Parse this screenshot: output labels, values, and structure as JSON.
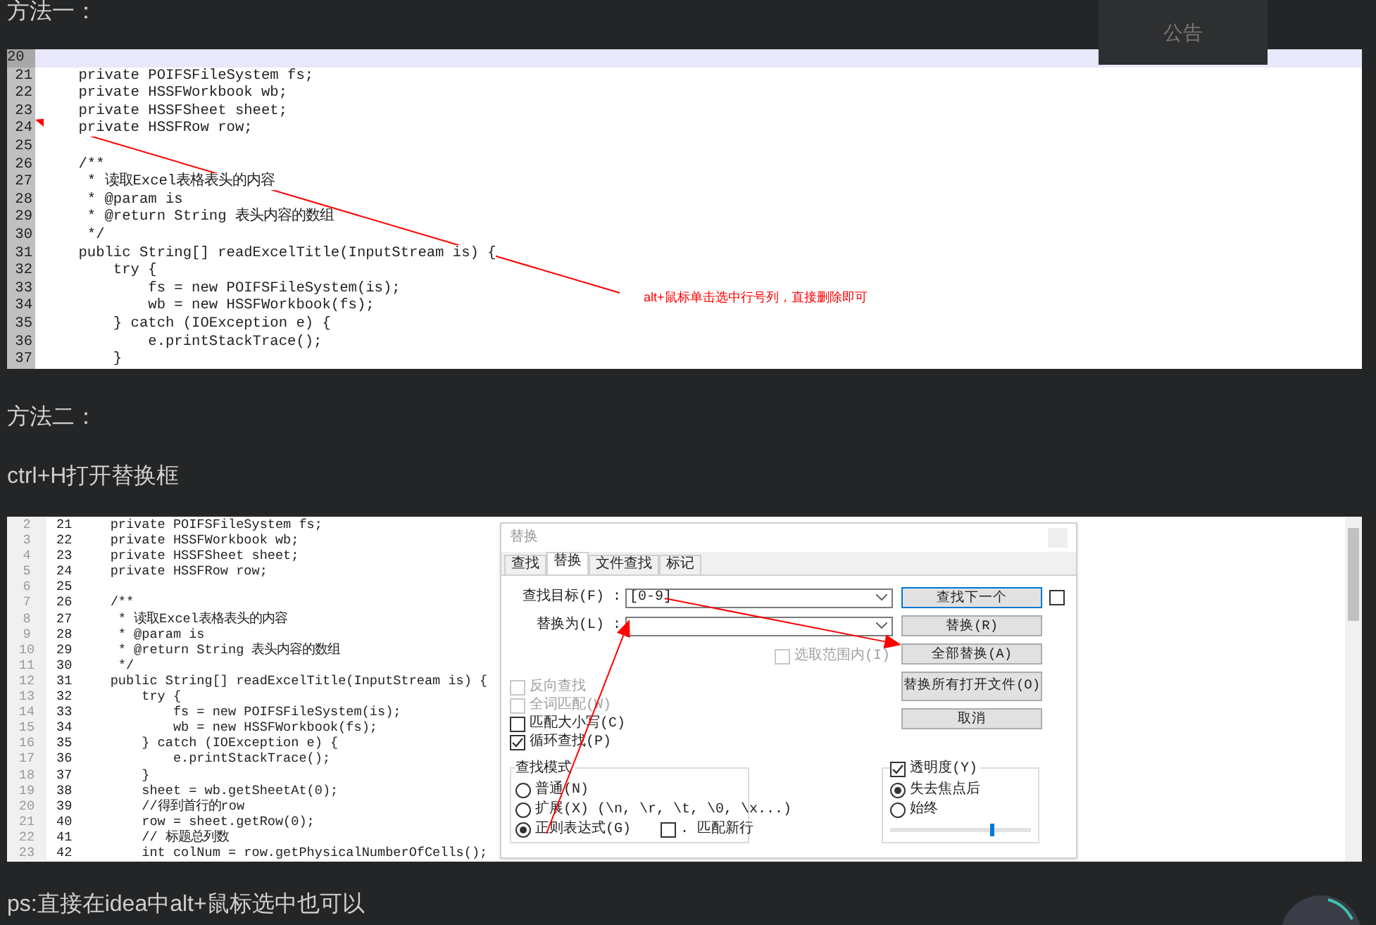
{
  "notice": "公告",
  "method_one": {
    "heading": "方法一：",
    "screenshot": {
      "lines": [
        {
          "number": "20",
          "selected": true
        },
        {
          "number": "21",
          "code": "    private POIFSFileSystem fs;",
          "selected": false
        },
        {
          "number": "22",
          "code": "    private HSSFWorkbook wb;",
          "selected": false
        },
        {
          "number": "23",
          "code": "    private HSSFSheet sheet;",
          "selected": false
        },
        {
          "number": "24",
          "code": "    private HSSFRow row;",
          "selected": false
        },
        {
          "number": "25",
          "selected": false
        },
        {
          "number": "26",
          "code": "    /**",
          "selected": false
        },
        {
          "number": "27",
          "code": "     * 读取Excel表格表头的内容",
          "selected": false
        },
        {
          "number": "28",
          "code": "     * @param is",
          "selected": false
        },
        {
          "number": "29",
          "code": "     * @return String 表头内容的数组",
          "selected": false
        },
        {
          "number": "30",
          "code": "     */",
          "selected": false
        },
        {
          "number": "31",
          "code": "    public String[] readExcelTitle(InputStream is) {",
          "selected": false
        },
        {
          "number": "32",
          "code": "        try {",
          "selected": false
        },
        {
          "number": "33",
          "code": "            fs = new POIFSFileSystem(is);",
          "selected": false
        },
        {
          "number": "34",
          "code": "            wb = new HSSFWorkbook(fs);",
          "selected": false
        },
        {
          "number": "35",
          "code": "        } catch (IOException e) {",
          "selected": false
        },
        {
          "number": "36",
          "code": "            e.printStackTrace();",
          "selected": false
        },
        {
          "number": "37",
          "code": "        }",
          "selected": false
        }
      ],
      "annotation": "alt+鼠标单击选中行号列，直接删除即可"
    }
  },
  "method_two": {
    "heading": "方法二：",
    "instruction": "ctrl+H打开替换框",
    "screenshot": {
      "lines": [
        {
          "row": "2",
          "number": "21",
          "code": "    private POIFSFileSystem fs;"
        },
        {
          "row": "3",
          "number": "22",
          "code": "    private HSSFWorkbook wb;"
        },
        {
          "row": "4",
          "number": "23",
          "code": "    private HSSFSheet sheet;"
        },
        {
          "row": "5",
          "number": "24",
          "code": "    private HSSFRow row;"
        },
        {
          "row": "6",
          "number": "25"
        },
        {
          "row": "7",
          "number": "26",
          "code": "    /**"
        },
        {
          "row": "8",
          "number": "27",
          "code": "     * 读取Excel表格表头的内容"
        },
        {
          "row": "9",
          "number": "28",
          "code": "     * @param is"
        },
        {
          "row": "10",
          "number": "29",
          "code": "     * @return String 表头内容的数组"
        },
        {
          "row": "11",
          "number": "30",
          "code": "     */"
        },
        {
          "row": "12",
          "number": "31",
          "code": "    public String[] readExcelTitle(InputStream is) {"
        },
        {
          "row": "13",
          "number": "32",
          "code": "        try {"
        },
        {
          "row": "14",
          "number": "33",
          "code": "            fs = new POIFSFileSystem(is);"
        },
        {
          "row": "15",
          "number": "34",
          "code": "            wb = new HSSFWorkbook(fs);"
        },
        {
          "row": "16",
          "number": "35",
          "code": "        } catch (IOException e) {"
        },
        {
          "row": "17",
          "number": "36",
          "code": "            e.printStackTrace();"
        },
        {
          "row": "18",
          "number": "37",
          "code": "        }"
        },
        {
          "row": "19",
          "number": "38",
          "code": "        sheet = wb.getSheetAt(0);"
        },
        {
          "row": "20",
          "number": "39",
          "code": "        //得到首行的row"
        },
        {
          "row": "21",
          "number": "40",
          "code": "        row = sheet.getRow(0);"
        },
        {
          "row": "22",
          "number": "41",
          "code": "        // 标题总列数"
        },
        {
          "row": "23",
          "number": "42",
          "code": "        int colNum = row.getPhysicalNumberOfCells();"
        }
      ],
      "dialog": {
        "title": "替换",
        "tabs": [
          {
            "label": "查找",
            "selected": false
          },
          {
            "label": "替换",
            "selected": true
          },
          {
            "label": "文件查找",
            "selected": false
          },
          {
            "label": "标记",
            "selected": false
          }
        ],
        "fields": [
          {
            "label": "查找目标(F) :",
            "value": "[0-9]"
          },
          {
            "label": "替换为(L) :"
          }
        ],
        "in_selection": {
          "label": "选取范围内(I)",
          "checked": false,
          "disabled": true
        },
        "buttons": [
          "查找下一个",
          "替换(R)",
          "全部替换(A)",
          "替换所有打开文件(O)",
          "取消"
        ],
        "side_checkbox": {
          "checked": false
        },
        "options": [
          {
            "label": "反向查找",
            "checked": false,
            "disabled": true
          },
          {
            "label": "全词匹配(W)",
            "checked": false,
            "disabled": true
          },
          {
            "label": "匹配大小写(C)",
            "checked": false,
            "disabled": false
          },
          {
            "label": "循环查找(P)",
            "checked": true,
            "disabled": false
          }
        ],
        "search_mode": {
          "title": "查找模式",
          "modes": [
            {
              "label": "普通(N)",
              "selected": false
            },
            {
              "label": "扩展(X) (\\n, \\r, \\t, \\0, \\x...)",
              "selected": false
            },
            {
              "label": "正则表达式(G)",
              "selected": true
            }
          ],
          "match_newline": {
            "label": ". 匹配新行",
            "checked": false
          }
        },
        "transparency": {
          "label": "透明度(Y)",
          "checked": true,
          "modes": [
            {
              "label": "失去焦点后",
              "selected": true
            },
            {
              "label": "始终",
              "selected": false
            }
          ],
          "level": 0.72
        }
      }
    }
  },
  "footer_note": "ps:直接在idea中alt+鼠标选中也可以"
}
